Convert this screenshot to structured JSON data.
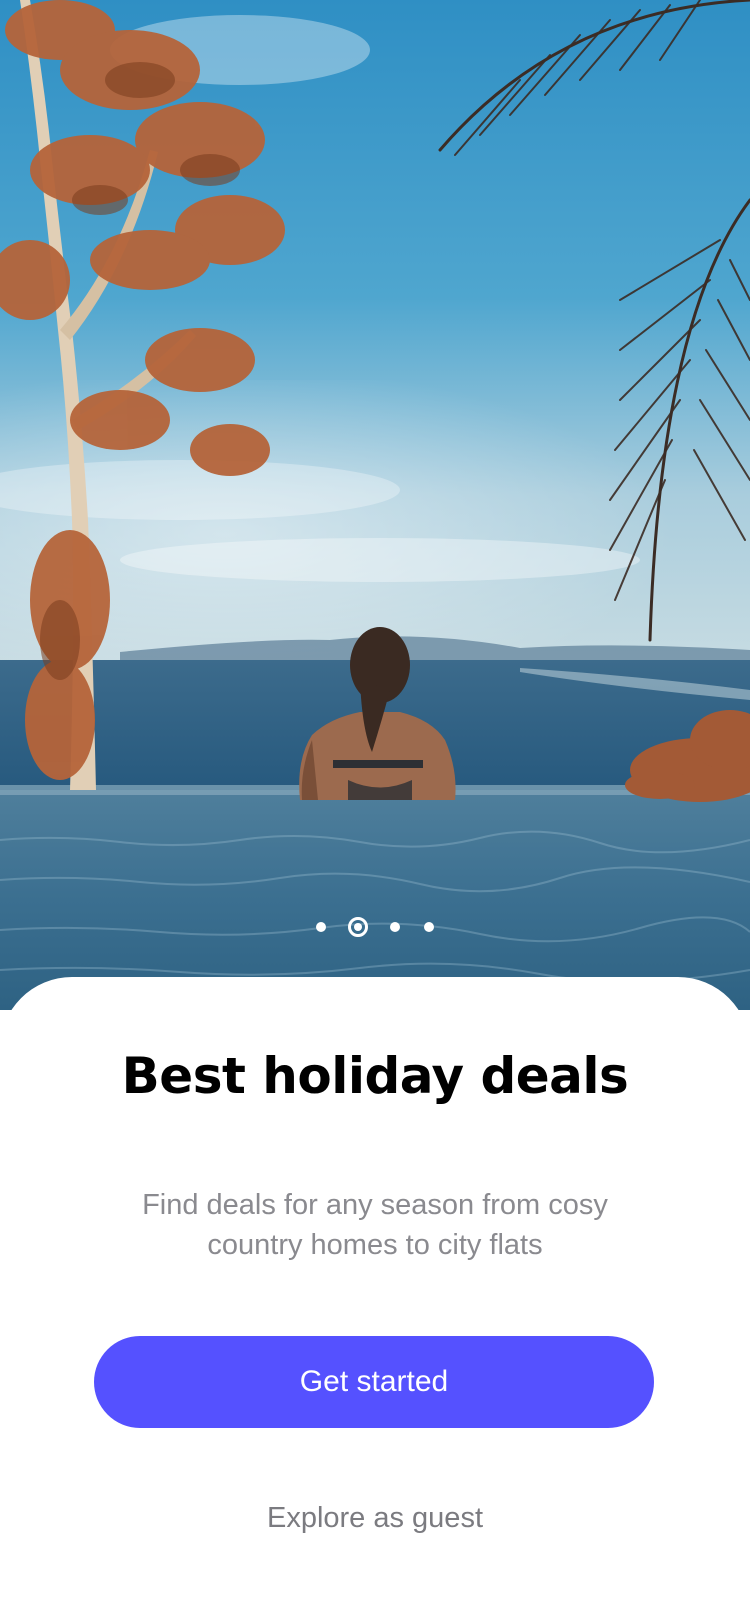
{
  "hero": {
    "image": "woman-in-infinity-pool-ocean-view-photo",
    "carousel": {
      "count": 4,
      "active_index": 1
    }
  },
  "onboarding": {
    "title": "Best holiday deals",
    "subtitle": "Find deals for any season from cosy country homes to city flats",
    "primary_button_label": "Get started",
    "secondary_link_label": "Explore as guest"
  },
  "colors": {
    "accent": "#5551FF",
    "title": "#000000",
    "subtitle": "#8A8A8F",
    "secondary_link": "#7B7B80",
    "background": "#FFFFFF"
  }
}
